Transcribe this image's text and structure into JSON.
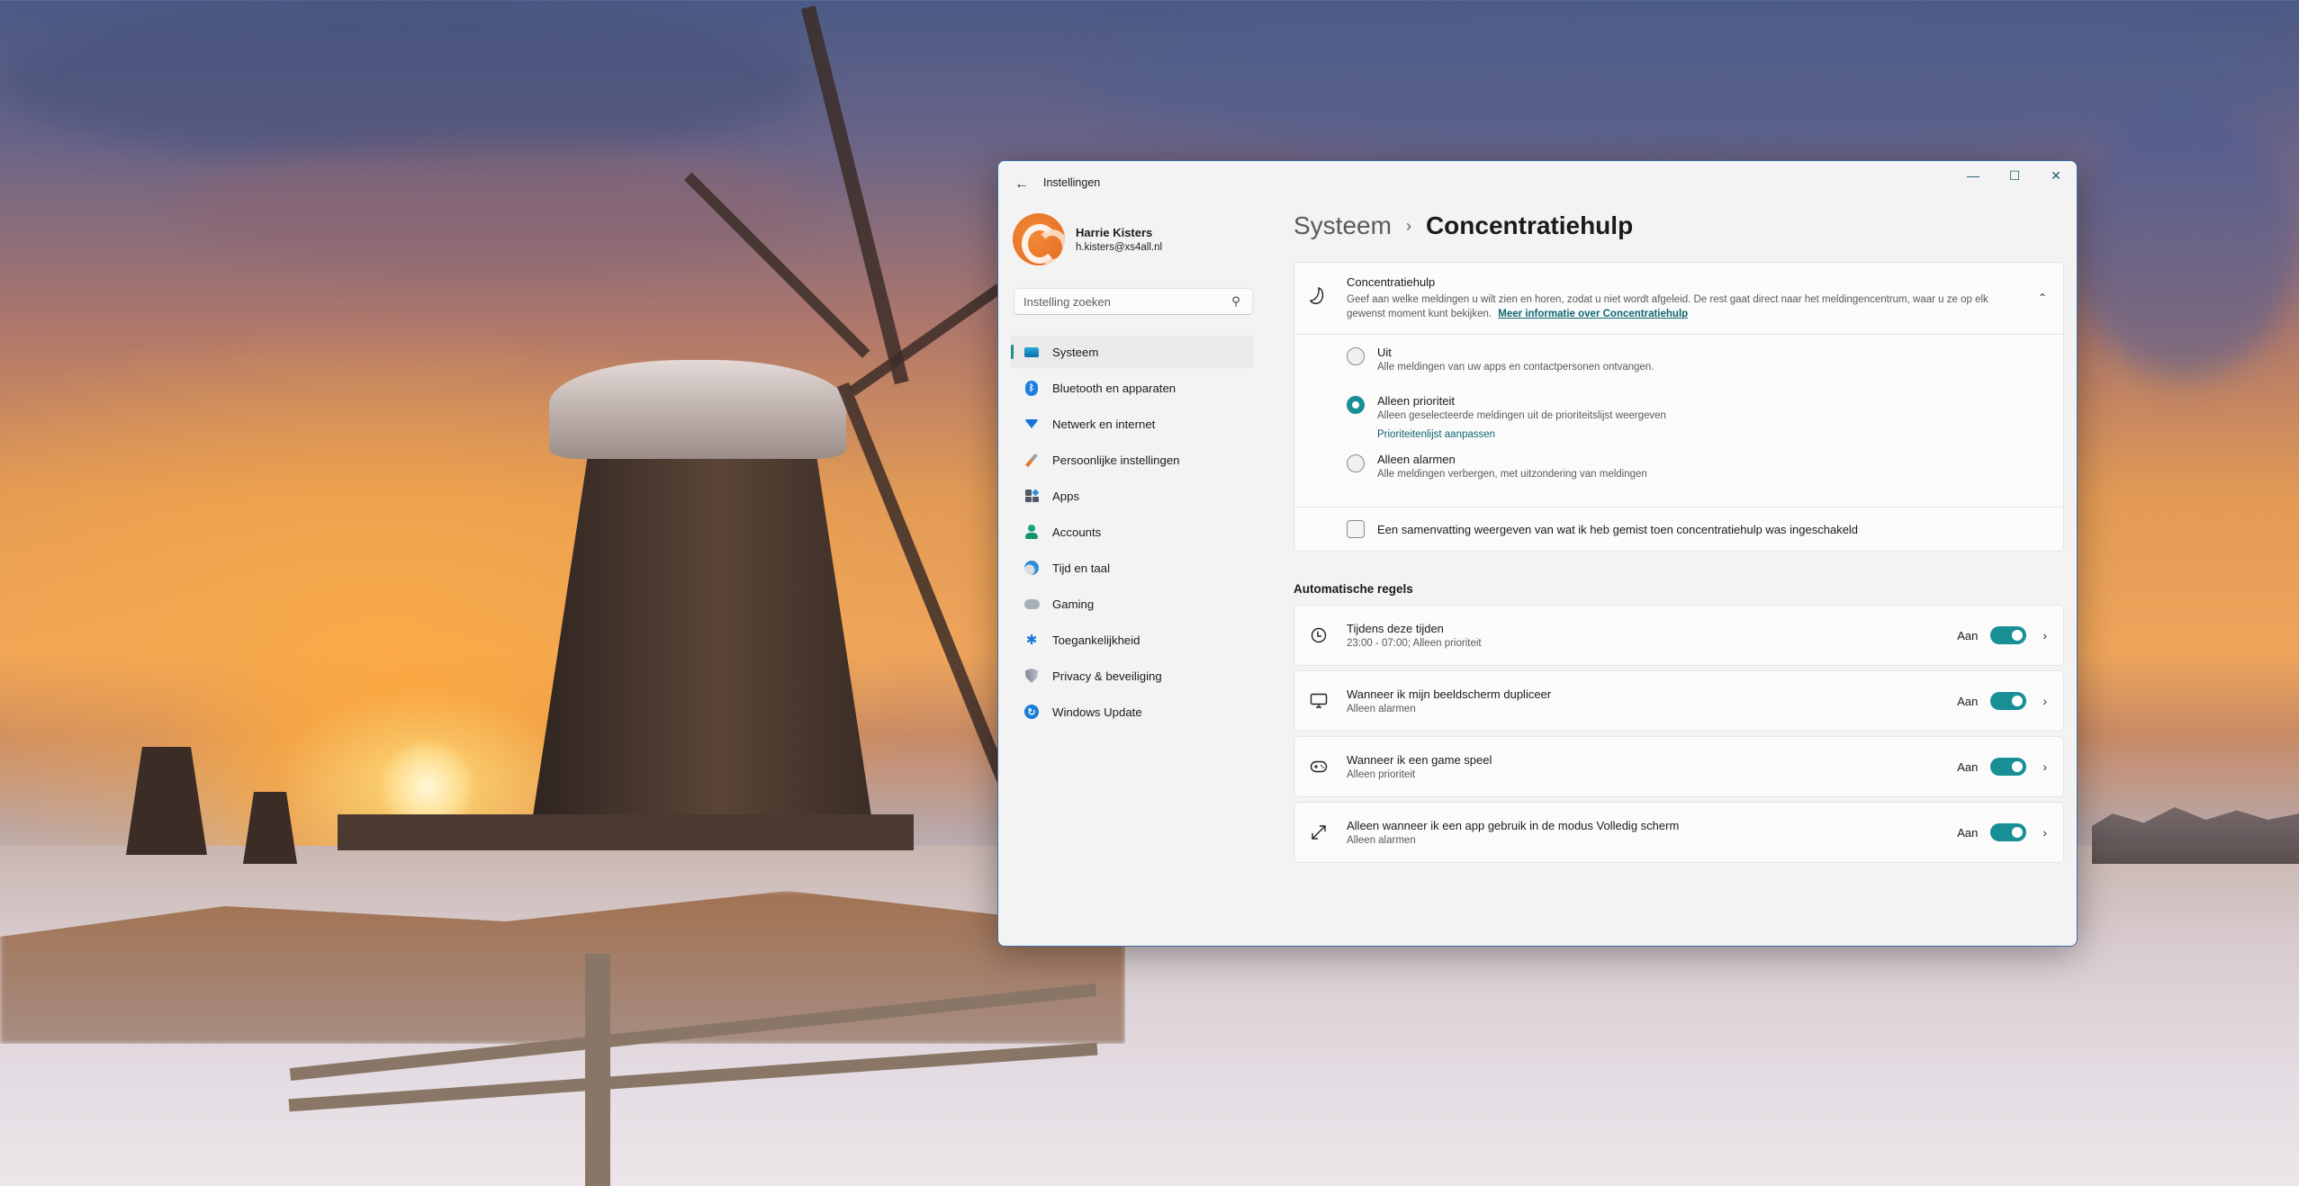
{
  "window": {
    "title": "Instellingen",
    "back_label": "←",
    "controls": {
      "minimize": "—",
      "maximize": "☐",
      "close": "✕"
    }
  },
  "profile": {
    "name": "Harrie Kisters",
    "email": "h.kisters@xs4all.nl"
  },
  "search": {
    "placeholder": "Instelling zoeken",
    "value": ""
  },
  "sidebar": {
    "items": [
      {
        "label": "Systeem",
        "icon": "system-icon",
        "active": true
      },
      {
        "label": "Bluetooth en apparaten",
        "icon": "bluetooth-icon"
      },
      {
        "label": "Netwerk en internet",
        "icon": "wifi-icon"
      },
      {
        "label": "Persoonlijke instellingen",
        "icon": "brush-icon"
      },
      {
        "label": "Apps",
        "icon": "apps-icon"
      },
      {
        "label": "Accounts",
        "icon": "account-icon"
      },
      {
        "label": "Tijd en taal",
        "icon": "time-language-icon"
      },
      {
        "label": "Gaming",
        "icon": "gamepad-icon"
      },
      {
        "label": "Toegankelijkheid",
        "icon": "accessibility-icon"
      },
      {
        "label": "Privacy & beveiliging",
        "icon": "shield-icon"
      },
      {
        "label": "Windows Update",
        "icon": "update-icon"
      }
    ]
  },
  "breadcrumb": {
    "parent": "Systeem",
    "separator": "›",
    "current": "Concentratiehulp"
  },
  "focus_assist": {
    "title": "Concentratiehulp",
    "description": "Geef aan welke meldingen u wilt zien en horen, zodat u niet wordt afgeleid. De rest gaat direct naar het meldingencentrum, waar u ze op elk gewenst moment kunt bekijken.",
    "link": "Meer informatie over Concentratiehulp",
    "expanded": true,
    "options": [
      {
        "title": "Uit",
        "description": "Alle meldingen van uw apps en contactpersonen ontvangen.",
        "selected": false
      },
      {
        "title": "Alleen prioriteit",
        "description": "Alleen geselecteerde meldingen uit de prioriteitslijst weergeven",
        "link": "Prioriteitenlijst aanpassen",
        "selected": true
      },
      {
        "title": "Alleen alarmen",
        "description": "Alle meldingen verbergen, met uitzondering van meldingen",
        "selected": false
      }
    ],
    "summary_checkbox": {
      "label": "Een samenvatting weergeven van wat ik heb gemist toen concentratiehulp was ingeschakeld",
      "checked": false
    }
  },
  "automatic_rules": {
    "title": "Automatische regels",
    "rules": [
      {
        "title": "Tijdens deze tijden",
        "subtitle": "23:00 - 07:00; Alleen prioriteit",
        "state_label": "Aan",
        "on": true,
        "icon": "clock-icon"
      },
      {
        "title": "Wanneer ik mijn beeldscherm dupliceer",
        "subtitle": "Alleen alarmen",
        "state_label": "Aan",
        "on": true,
        "icon": "monitor-icon"
      },
      {
        "title": "Wanneer ik een game speel",
        "subtitle": "Alleen prioriteit",
        "state_label": "Aan",
        "on": true,
        "icon": "gamepad-icon"
      },
      {
        "title": "Alleen wanneer ik een app gebruik in de modus Volledig scherm",
        "subtitle": "Alleen alarmen",
        "state_label": "Aan",
        "on": true,
        "icon": "fullscreen-icon"
      }
    ]
  },
  "colors": {
    "accent": "#178f95",
    "link": "#0f6670",
    "window_bg": "#f3f3f3",
    "card_bg": "#fbfbfb"
  }
}
